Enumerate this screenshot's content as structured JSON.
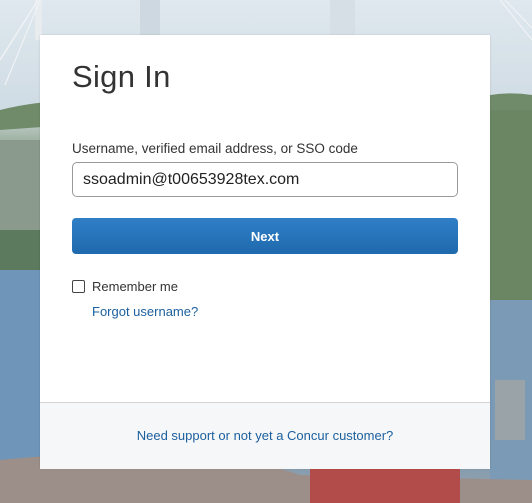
{
  "signin": {
    "title": "Sign In",
    "username_label": "Username, verified email address, or SSO code",
    "username_value": "ssoadmin@t00653928tex.com",
    "next_label": "Next",
    "remember_label": "Remember me",
    "forgot_label": "Forgot username?"
  },
  "footer": {
    "support_label": "Need support or not yet a Concur customer?"
  },
  "colors": {
    "primary": "#1f69ad",
    "link": "#1b5f9e"
  }
}
